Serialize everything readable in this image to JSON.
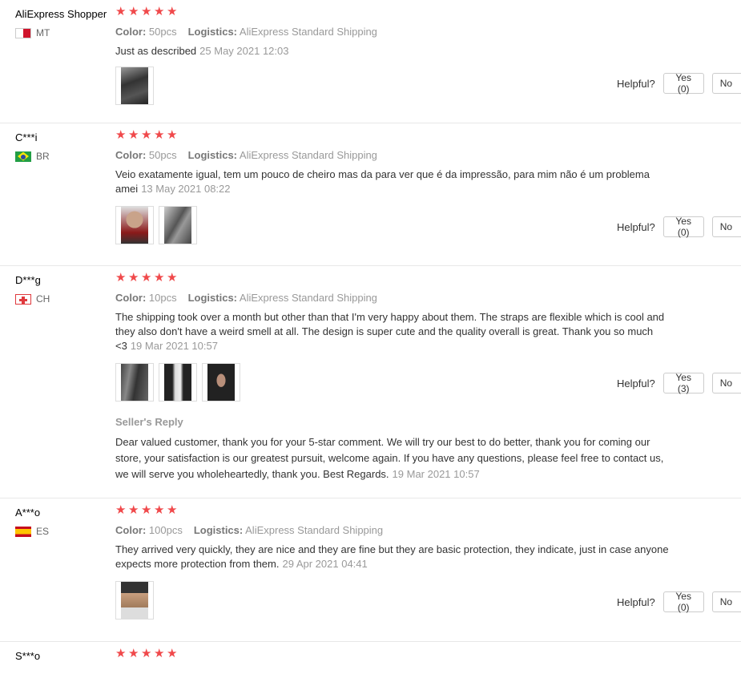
{
  "labels": {
    "color": "Color:",
    "logistics": "Logistics:",
    "helpful": "Helpful?",
    "no": "No",
    "seller_reply": "Seller's Reply"
  },
  "star_color": "#f0494b",
  "reviews": [
    {
      "name": "AliExpress Shopper",
      "country": "MT",
      "flag": "malta-flag-icon",
      "stars": 5,
      "color": "50pcs",
      "logistics": "AliExpress Standard Shipping",
      "text": "Just as described",
      "date": "25 May 2021 12:03",
      "photos": 1,
      "yes": "Yes (0)"
    },
    {
      "name": "C***i",
      "country": "BR",
      "flag": "brazil-flag-icon",
      "stars": 5,
      "color": "50pcs",
      "logistics": "AliExpress Standard Shipping",
      "text": "Veio exatamente igual, tem um pouco de cheiro mas da para ver que é da impressão, para mim não é um problema amei",
      "date": "13 May 2021 08:22",
      "photos": 2,
      "yes": "Yes (0)"
    },
    {
      "name": "D***g",
      "country": "CH",
      "flag": "switzerland-flag-icon",
      "stars": 5,
      "color": "10pcs",
      "logistics": "AliExpress Standard Shipping",
      "text": "The shipping took over a month but other than that I'm very happy about them. The straps are flexible which is cool and they also don't have a weird smell at all. The design is super cute and the quality overall is great. Thank you so much <3",
      "date": "19 Mar 2021 10:57",
      "photos": 3,
      "yes": "Yes (3)",
      "seller_reply": {
        "text": "Dear valued customer, thank you for your 5-star comment. We will try our best to do better, thank you for coming our store, your satisfaction is our greatest pursuit, welcome again. If you have any questions, please feel free to contact us, we will serve you wholeheartedly, thank you. Best Regards.",
        "date": "19 Mar 2021 10:57"
      }
    },
    {
      "name": "A***o",
      "country": "ES",
      "flag": "spain-flag-icon",
      "stars": 5,
      "color": "100pcs",
      "logistics": "AliExpress Standard Shipping",
      "text": "They arrived very quickly, they are nice and they are fine but they are basic protection, they indicate, just in case anyone expects more protection from them.",
      "date": "29 Apr 2021 04:41",
      "photos": 1,
      "yes": "Yes (0)"
    },
    {
      "name": "S***o",
      "stars": 5
    }
  ]
}
